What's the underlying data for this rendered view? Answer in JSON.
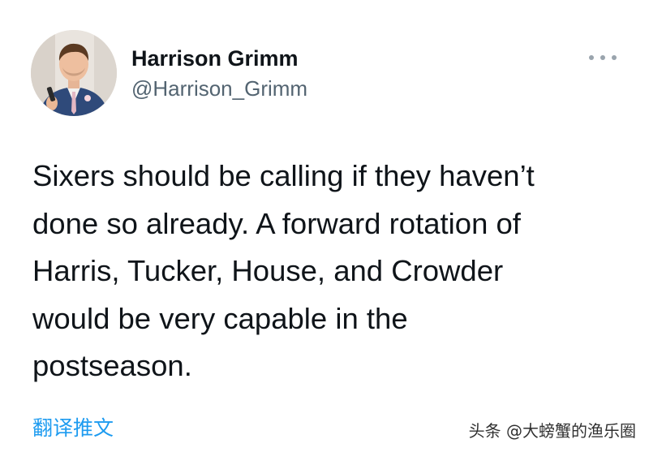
{
  "tweet": {
    "author": {
      "display_name": "Harrison Grimm",
      "handle": "@Harrison_Grimm",
      "avatar": "profile-photo"
    },
    "more_icon": "more-horizontal-icon",
    "text_lines": [
      "Sixers should be calling if they haven’t",
      "done so already. A forward rotation of",
      "Harris, Tucker, House, and Crowder",
      "would be very capable in the",
      "postseason."
    ],
    "translate_label": "翻译推文"
  },
  "watermark": {
    "text": "头条 @大螃蟹的渔乐圈"
  },
  "colors": {
    "link": "#1d9bf0",
    "handle": "#536471",
    "text": "#0f1419"
  }
}
